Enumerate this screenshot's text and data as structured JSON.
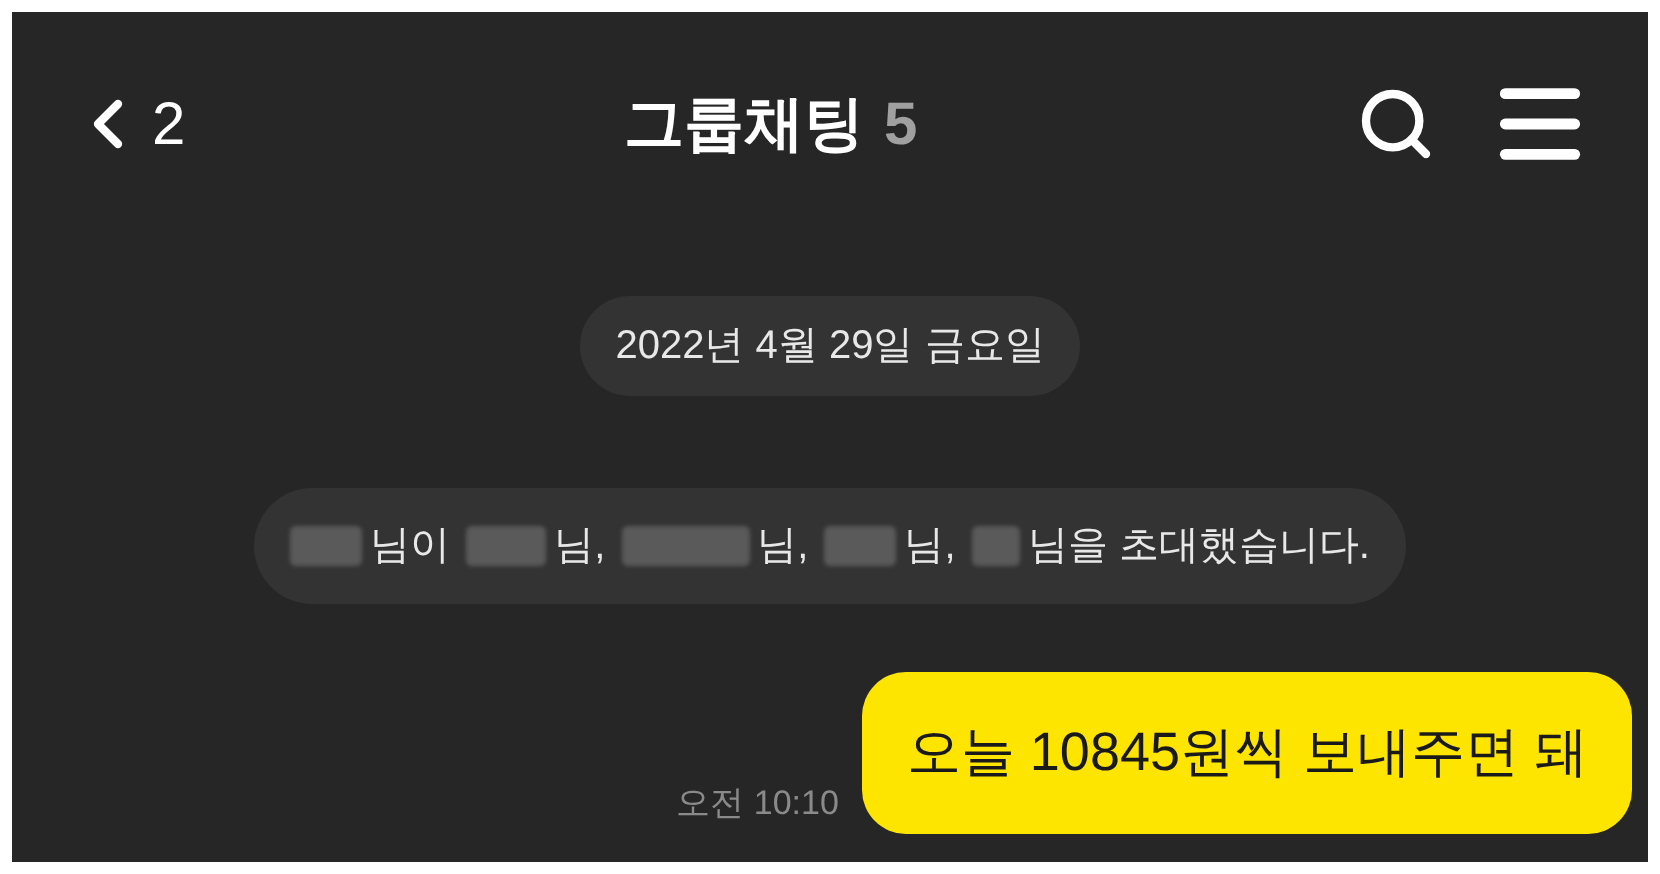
{
  "header": {
    "back_count": "2",
    "title": "그룹채팅",
    "member_count": "5"
  },
  "date_divider": "2022년 4월 29일 금요일",
  "invite_message": {
    "parts": [
      "님이",
      "님,",
      "님,",
      "님,",
      "님을 초대했습니다."
    ]
  },
  "messages": [
    {
      "kind": "mine",
      "text": "오늘 10845원씩 보내주면 돼",
      "time": "오전 10:10"
    }
  ]
}
